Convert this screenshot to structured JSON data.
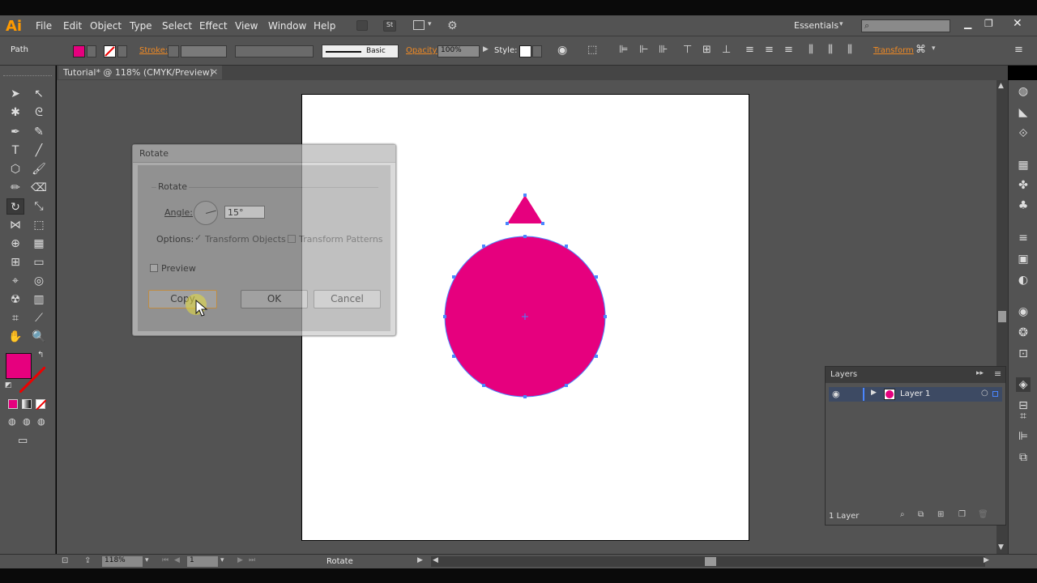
{
  "app": {
    "logo": "Ai",
    "menu": [
      "File",
      "Edit",
      "Object",
      "Type",
      "Select",
      "Effect",
      "View",
      "Window",
      "Help"
    ],
    "workspace": "Essentials",
    "search_placeholder": ""
  },
  "control": {
    "selection": "Path",
    "stroke_label": "Stroke:",
    "brush": "Basic",
    "opacity_label": "Opacity:",
    "opacity_value": "100%",
    "style_label": "Style:",
    "transform_label": "Transform",
    "fill_color": "#e6007e"
  },
  "document": {
    "tab_title": "Tutorial* @ 118% (CMYK/Preview)",
    "shape_color": "#e6007e"
  },
  "dialog": {
    "title": "Rotate",
    "section": "Rotate",
    "angle_label": "Angle:",
    "angle_value": "15°",
    "options_label": "Options:",
    "opt_transform_objects": "Transform Objects",
    "opt_transform_patterns": "Transform Patterns",
    "preview_label": "Preview",
    "copy": "Copy",
    "ok": "OK",
    "cancel": "Cancel"
  },
  "layers": {
    "title": "Layers",
    "layer_name": "Layer 1",
    "count": "1 Layer"
  },
  "status": {
    "zoom": "118%",
    "artboard": "1",
    "tool": "Rotate"
  }
}
